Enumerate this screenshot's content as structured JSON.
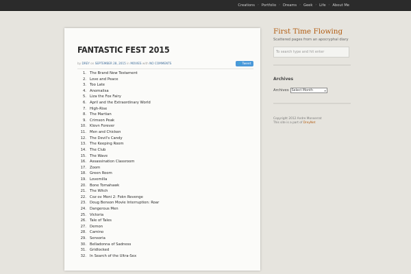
{
  "topnav": {
    "items": [
      "Creations",
      "Portfolio",
      "Dreams",
      "Geek",
      "Life",
      "About Me"
    ]
  },
  "post": {
    "title": "FANTASTIC FEST 2015",
    "meta": {
      "by": "by",
      "author": "DREY",
      "on": "on",
      "date": "SEPTEMBER 28, 2015",
      "in": "in",
      "category": "MOVIES",
      "with": "with",
      "comments": "NO COMMENTS"
    },
    "tweet_label": "Tweet",
    "movies": [
      "The Brand New Testament",
      "Love and Peace",
      "Too Late",
      "Anomalisa",
      "Liza the Fox Fairy",
      "April and the Extraordinary World",
      "High-Rise",
      "The Martian",
      "Crimson Peak",
      "Klovn Forever",
      "Men and Chicken",
      "The Devil's Candy",
      "The Keeping Room",
      "The Club",
      "The Wave",
      "Assassination Classroom",
      "Zoom",
      "Green Room",
      "Lovemilla",
      "Bone Tomahawk",
      "The Witch",
      "Coz ov Moni 2: Fokn Revenge",
      "Doug Benson Movie Interruption: Roar",
      "Dangerous Men",
      "Victoria",
      "Tale of Tales",
      "Demon",
      "Camino",
      "Sensoria",
      "Belladonna of Sadness",
      "Gridlocked",
      "In Search of the Ultra-Sex"
    ]
  },
  "sidebar": {
    "blog_title": "First Time Flowing",
    "tagline": "Scattered pages from an apocryphal diary",
    "search_placeholder": "To search type and hit enter",
    "archives_title": "Archives",
    "archives_label": "Archives",
    "archives_select_value": "Select Month",
    "footer_line1": "Copyright 2012 Andre Monserrat",
    "footer_line2_prefix": "This site is a part of",
    "footer_line2_link": "DreyNet"
  },
  "colors": {
    "accent": "#b25d12",
    "link": "#3f6d9a",
    "tweet": "#4a98d9",
    "topbar": "#2b2b2b"
  }
}
